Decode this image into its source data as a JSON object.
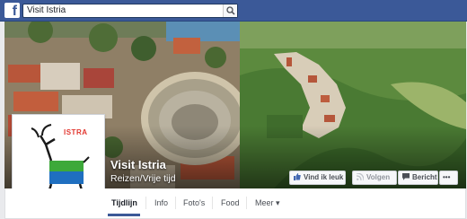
{
  "topbar": {
    "logo_letter": "f",
    "search": {
      "value": "Visit Istria",
      "placeholder": ""
    }
  },
  "cover": {
    "page_name": "Visit Istria",
    "category": "Reizen/Vrije tijd"
  },
  "profile": {
    "logo_text": "ISTRA",
    "icon": "goat-logo-icon"
  },
  "actions": {
    "like_label": "Vind ik leuk",
    "follow_label": "Volgen",
    "message_label": "Bericht",
    "more_label": "•••"
  },
  "tabs": [
    {
      "label": "Tijdlijn",
      "active": true
    },
    {
      "label": "Info"
    },
    {
      "label": "Foto's"
    },
    {
      "label": "Food"
    },
    {
      "label": "Meer ▾"
    }
  ],
  "colors": {
    "brand": "#3b5998",
    "cover_green": "#5c8a3e",
    "sea": "#3f7da8"
  }
}
